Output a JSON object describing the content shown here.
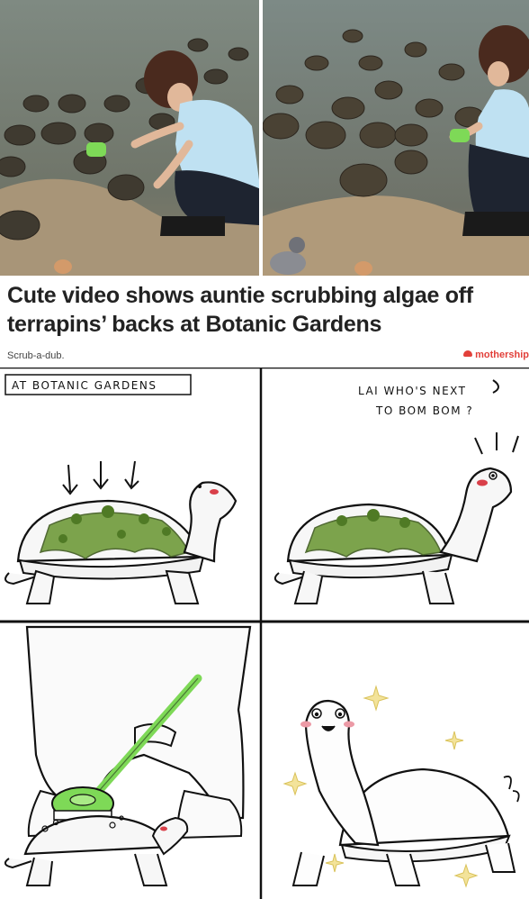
{
  "article": {
    "headline_line1": "Cute video shows auntie scrubbing algae off",
    "headline_line2": "terrapins’ backs at Botanic Gardens",
    "caption": "Scrub-a-dub.",
    "brand": "mothership"
  },
  "comic": {
    "panel1_label": "AT BOTANIC GARDENS",
    "panel2_speech_line1": "LAI WHO'S NEXT",
    "panel2_speech_line2": "TO BOM BOM ?"
  },
  "colors": {
    "headline": "#222222",
    "brand": "#e2403a",
    "algae": "#6f9a3a",
    "brush": "#7ed957"
  }
}
